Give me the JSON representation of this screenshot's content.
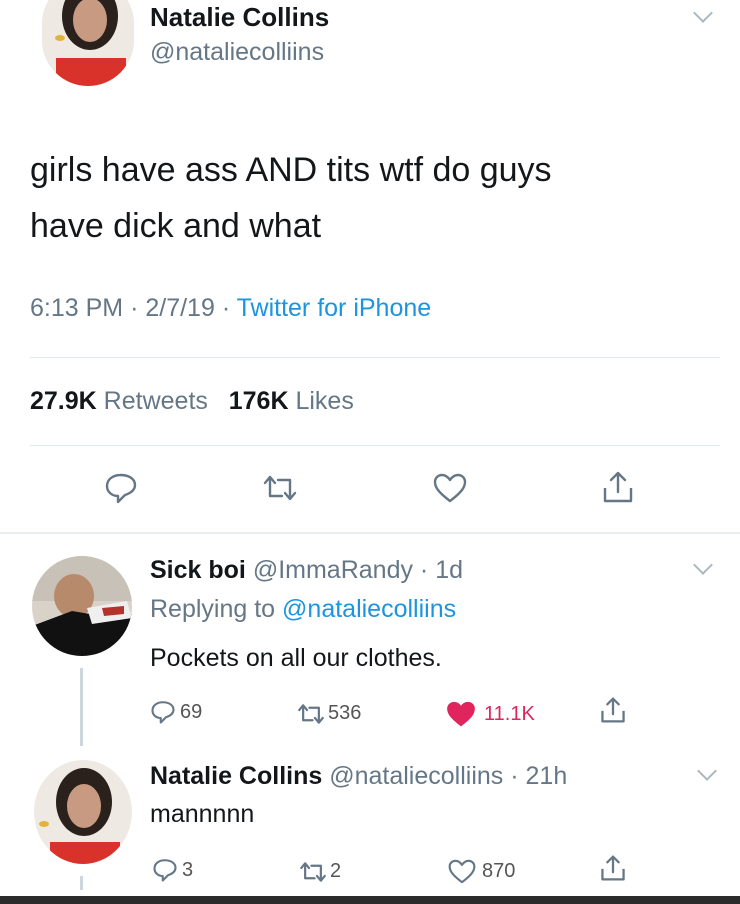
{
  "tweet": {
    "author_name": "Natalie Collins",
    "author_handle": "@nataliecolliins",
    "text_line1": "girls have ass AND tits wtf do guys",
    "text_line2": "have dick and what",
    "time": "6:13 PM",
    "date": "2/7/19",
    "source": "Twitter for iPhone",
    "retweets_count": "27.9K",
    "retweets_label": "Retweets",
    "likes_count": "176K",
    "likes_label": "Likes",
    "actions": [
      "reply-icon",
      "retweet-icon",
      "heart-icon",
      "share-icon"
    ]
  },
  "reply1": {
    "author_name": "Sick boi",
    "author_handle": "@ImmaRandy",
    "age": "1d",
    "replying_prefix": "Replying to",
    "replying_handle": "@nataliecolliins",
    "text": "Pockets on all our clothes.",
    "reply_count": "69",
    "retweet_count": "536",
    "like_count": "11.1K",
    "liked": true,
    "like_color": "#e0245e"
  },
  "reply2": {
    "author_name": "Natalie Collins",
    "author_handle": "@nataliecolliins",
    "age": "21h",
    "text": "mannnnn",
    "reply_count": "3",
    "retweet_count": "2",
    "like_count": "870"
  },
  "colors": {
    "accent": "#1b95e0",
    "muted": "#657786",
    "like": "#e0245e"
  }
}
